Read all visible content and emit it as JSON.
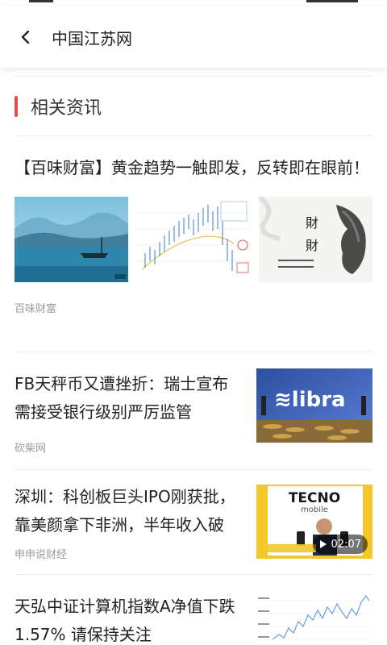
{
  "header": {
    "title": "中国江苏网"
  },
  "section": {
    "title": "相关资讯",
    "accent_color": "#e84c47"
  },
  "articles": [
    {
      "title": "【百味财富】黄金趋势一触即发，反转即在眼前！",
      "source": "百味财富",
      "image_count": 3
    },
    {
      "title": "FB天秤币又遭挫折：瑞士宣布需接受银行级别严厉监管",
      "source": "砍柴网",
      "thumb_text": "≋libra"
    },
    {
      "title": "深圳：科创板巨头IPO刚获批，靠美颜拿下非洲，半年收入破",
      "source": "申申说财经",
      "thumb_brand": "TECNO",
      "thumb_sub": "mobile",
      "video_duration": "02:07"
    },
    {
      "title": "天弘中证计算机指数A净值下跌1.57% 请保持关注",
      "source": ""
    }
  ]
}
